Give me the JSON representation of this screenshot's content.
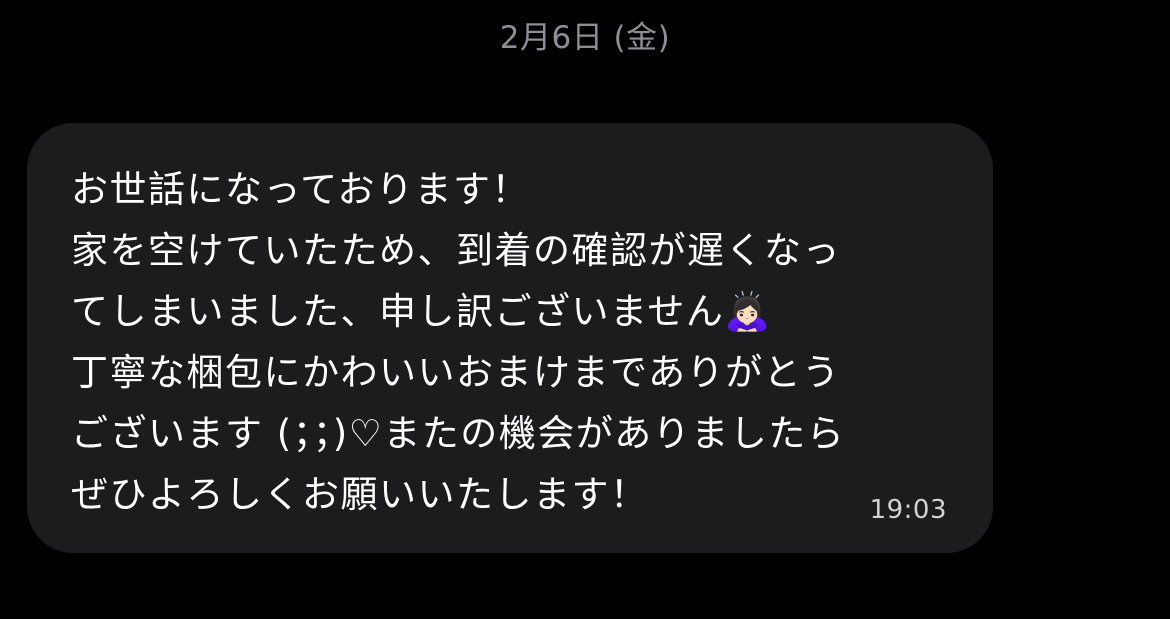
{
  "chat": {
    "date_header": "2月6日 (金)",
    "message": {
      "text": "お世話になっております！\n家を空けていたため、到着の確認が遅くなっ\nてしまいました、申し訳ございません🙇🏻‍♀️\n丁寧な梱包にかわいいおまけまでありがとう\nございます (；；)♡またの機会がありましたら\nぜひよろしくお願いいたします！",
      "time": "19:03"
    }
  },
  "colors": {
    "background": "#000000",
    "bubble": "#1c1c1e",
    "text": "#ffffff",
    "secondary_text": "#8e8e93"
  }
}
